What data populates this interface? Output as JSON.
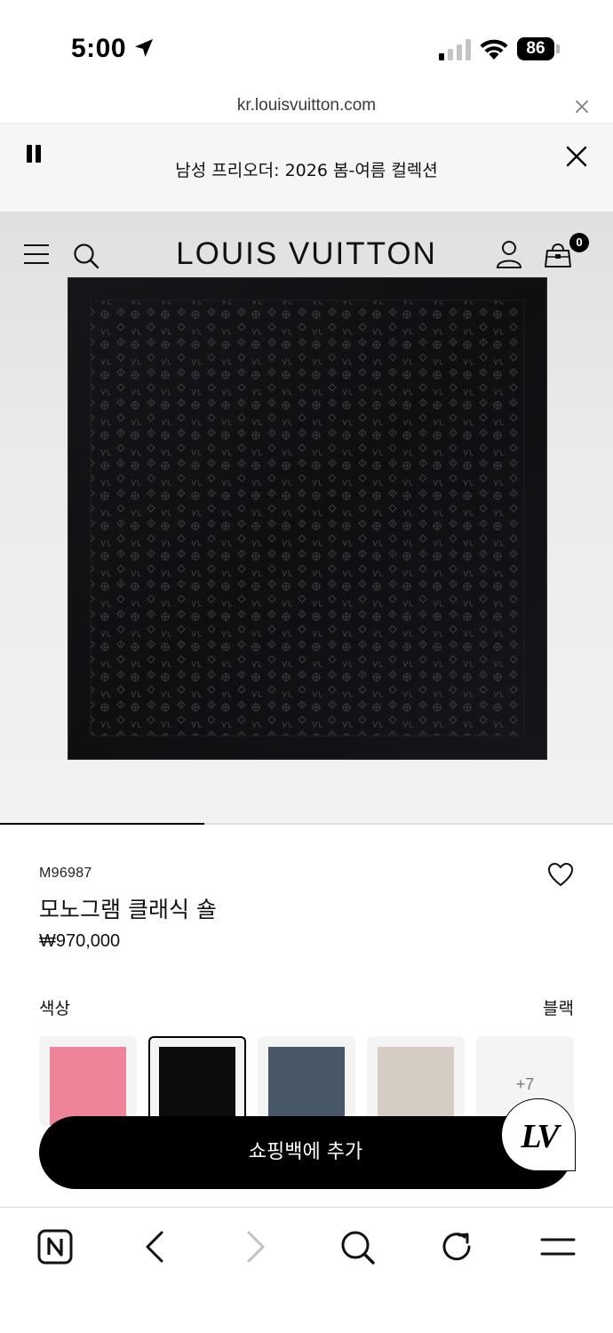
{
  "status_bar": {
    "time": "5:00",
    "battery": "86"
  },
  "url_bar": {
    "url": "kr.louisvuitton.com"
  },
  "announcement": {
    "text": "남성 프리오더: 2026 봄-여름 컬렉션"
  },
  "header": {
    "brand": "LOUIS VUITTON",
    "bag_count": "0"
  },
  "carousel": {
    "progress": 0.333
  },
  "product": {
    "sku": "M96987",
    "name": "모노그램 클래식 숄",
    "price": "₩970,000"
  },
  "color_selector": {
    "label": "색상",
    "selected": "블랙",
    "swatches": [
      {
        "name": "pink",
        "color": "#ee8497",
        "selected": false
      },
      {
        "name": "black",
        "color": "#0c0c0e",
        "selected": true
      },
      {
        "name": "denim",
        "color": "#475768",
        "selected": false
      },
      {
        "name": "beige",
        "color": "#d5cdc3",
        "selected": false
      }
    ],
    "more_label": "+7"
  },
  "cta": {
    "add_to_bag": "쇼핑백에 추가",
    "badge": "LV"
  },
  "colors": {
    "shawl": "#121215",
    "shawl_pattern": "#3a3a42",
    "cta_background": "#000000"
  },
  "toolbar": {
    "icons": [
      "n-logo-icon",
      "back-icon",
      "forward-icon",
      "search-icon",
      "refresh-icon",
      "menu-icon"
    ]
  }
}
